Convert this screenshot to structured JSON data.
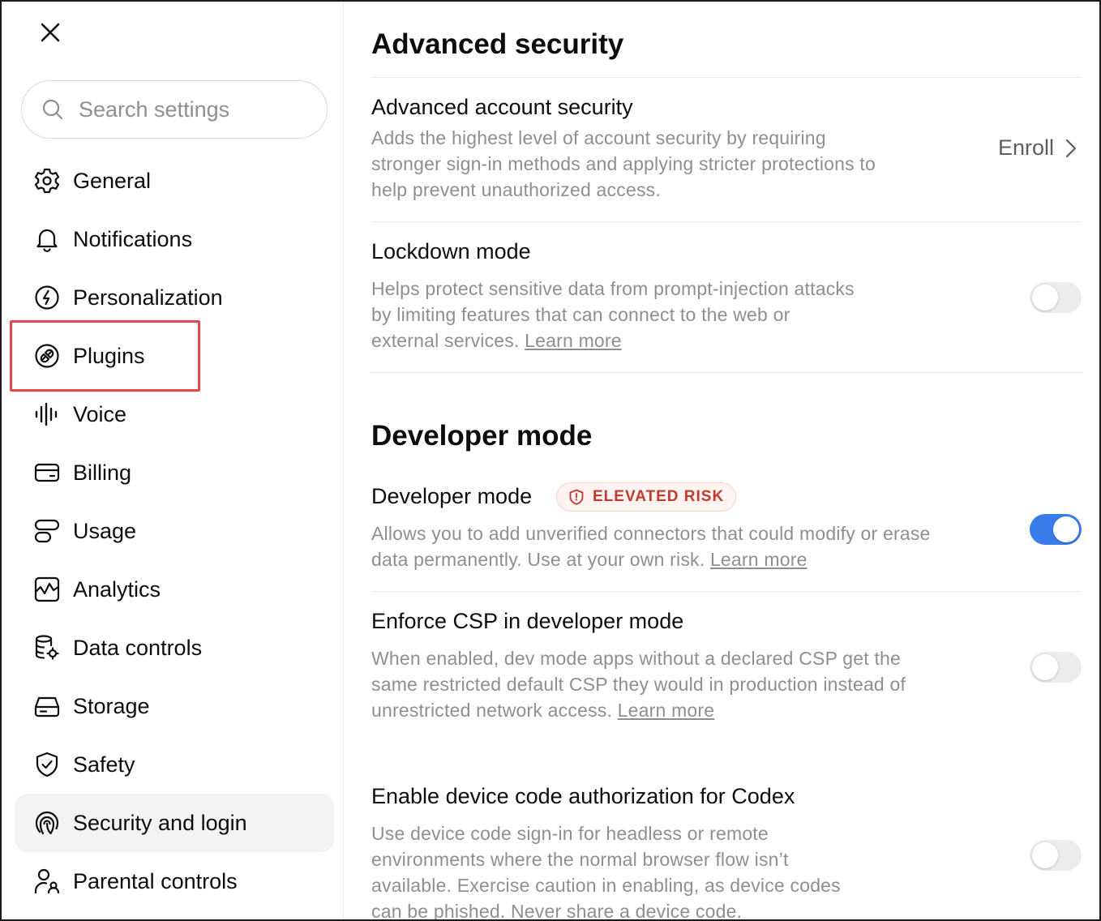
{
  "sidebar": {
    "close_label": "Close",
    "search": {
      "placeholder": "Search settings",
      "value": ""
    },
    "items": [
      {
        "label": "General",
        "icon": "gear-icon"
      },
      {
        "label": "Notifications",
        "icon": "bell-icon"
      },
      {
        "label": "Personalization",
        "icon": "personalization-icon"
      },
      {
        "label": "Plugins",
        "icon": "plugin-icon"
      },
      {
        "label": "Voice",
        "icon": "voice-waveform-icon"
      },
      {
        "label": "Billing",
        "icon": "credit-card-icon"
      },
      {
        "label": "Usage",
        "icon": "usage-icon"
      },
      {
        "label": "Analytics",
        "icon": "analytics-chart-icon"
      },
      {
        "label": "Data controls",
        "icon": "database-settings-icon"
      },
      {
        "label": "Storage",
        "icon": "storage-drive-icon"
      },
      {
        "label": "Safety",
        "icon": "shield-check-icon"
      },
      {
        "label": "Security and login",
        "icon": "fingerprint-icon",
        "active": true
      },
      {
        "label": "Parental controls",
        "icon": "parent-child-icon"
      }
    ]
  },
  "main": {
    "advanced_security": {
      "title": "Advanced security",
      "account_security": {
        "title": "Advanced account security",
        "description": "Adds the highest level of account security by requiring stronger sign-in methods and applying stricter protections to help prevent unauthorized access.",
        "action_label": "Enroll"
      },
      "lockdown": {
        "title": "Lockdown mode",
        "description": "Helps protect sensitive data from prompt-injection attacks by limiting features that can connect to the web or external services.",
        "link": "Learn more",
        "enabled": false
      }
    },
    "developer_mode": {
      "title": "Developer mode",
      "toggle_row": {
        "title": "Developer mode",
        "badge": "ELEVATED RISK",
        "description": "Allows you to add unverified connectors that could modify or erase data permanently. Use at your own risk.",
        "link": "Learn more",
        "enabled": true
      },
      "csp": {
        "title": "Enforce CSP in developer mode",
        "description": "When enabled, dev mode apps without a declared CSP get the same restricted default CSP they would in production instead of unrestricted network access.",
        "link": "Learn more",
        "enabled": false
      },
      "device_code": {
        "title": "Enable device code authorization for Codex",
        "description": "Use device code sign-in for headless or remote environments where the normal browser flow isn’t available. Exercise caution in enabling, as device codes can be phished. Never share a device code.",
        "enabled": false
      }
    }
  },
  "colors": {
    "accent": "#3a7bea",
    "highlight": "#e5484d",
    "badge_text": "#c23a2b",
    "muted_text": "#8f8f8f"
  }
}
